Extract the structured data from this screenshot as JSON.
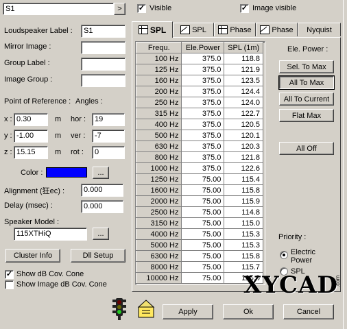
{
  "top": {
    "selector_value": "S1",
    "nav_arrow": ">",
    "visible_label": "Visible",
    "image_visible_label": "Image visible"
  },
  "left": {
    "loudspeaker_label": "Loudspeaker Label :",
    "loudspeaker_value": "S1",
    "mirror_image": "Mirror Image :",
    "group_label": "Group Label :",
    "image_group": "Image Group :",
    "point_of_reference": "Point of Reference :",
    "angles": "Angles :",
    "x_label": "x :",
    "x_value": "0.30",
    "x_unit": "m",
    "y_label": "y :",
    "y_value": "-1.00",
    "y_unit": "m",
    "z_label": "z :",
    "z_value": "15.15",
    "z_unit": "m",
    "hor_label": "hor :",
    "hor_value": "19",
    "ver_label": "ver :",
    "ver_value": "-7",
    "rot_label": "rot :",
    "rot_value": "0",
    "color_label": "Color :",
    "color_value": "#0000ff",
    "ellipsis": "...",
    "alignment_label": "Alignment (狂ec) :",
    "alignment_value": "0.000",
    "delay_label": "Delay (msec) :",
    "delay_value": "0.000",
    "speaker_model_label": "Speaker Model :",
    "speaker_model_value": "115XTHiQ",
    "cluster_info": "Cluster Info",
    "dll_setup": "Dll Setup",
    "show_db_cov": "Show dB Cov. Cone",
    "show_image_db_cov": "Show Image dB Cov. Cone"
  },
  "tabs": [
    {
      "label": "SPL",
      "icon": "grid-icon"
    },
    {
      "label": "SPL",
      "icon": "graph-icon"
    },
    {
      "label": "Phase",
      "icon": "grid-icon"
    },
    {
      "label": "Phase",
      "icon": "graph-icon"
    },
    {
      "label": "Nyquist",
      "icon": ""
    }
  ],
  "table": {
    "headers": [
      "Frequ.",
      "Ele.Power",
      "SPL (1m)"
    ],
    "rows": [
      [
        "100 Hz",
        "375.0",
        "118.8"
      ],
      [
        "125 Hz",
        "375.0",
        "121.9"
      ],
      [
        "160 Hz",
        "375.0",
        "123.5"
      ],
      [
        "200 Hz",
        "375.0",
        "124.4"
      ],
      [
        "250 Hz",
        "375.0",
        "124.0"
      ],
      [
        "315 Hz",
        "375.0",
        "122.7"
      ],
      [
        "400 Hz",
        "375.0",
        "120.5"
      ],
      [
        "500 Hz",
        "375.0",
        "120.1"
      ],
      [
        "630 Hz",
        "375.0",
        "120.3"
      ],
      [
        "800 Hz",
        "375.0",
        "121.8"
      ],
      [
        "1000 Hz",
        "375.0",
        "122.6"
      ],
      [
        "1250 Hz",
        "75.00",
        "115.4"
      ],
      [
        "1600 Hz",
        "75.00",
        "115.8"
      ],
      [
        "2000 Hz",
        "75.00",
        "115.9"
      ],
      [
        "2500 Hz",
        "75.00",
        "114.8"
      ],
      [
        "3150 Hz",
        "75.00",
        "115.0"
      ],
      [
        "4000 Hz",
        "75.00",
        "115.3"
      ],
      [
        "5000 Hz",
        "75.00",
        "115.3"
      ],
      [
        "6300 Hz",
        "75.00",
        "115.8"
      ],
      [
        "8000 Hz",
        "75.00",
        "115.7"
      ],
      [
        "10000 Hz",
        "75.00",
        "115.0"
      ]
    ]
  },
  "right": {
    "ele_power": "Ele. Power :",
    "sel_to_max": "Sel. To Max",
    "all_to_max": "All To Max",
    "all_to_current": "All To Current",
    "flat_max": "Flat Max",
    "all_off": "All Off",
    "priority": "Priority :",
    "electric_power": "Electric Power",
    "spl": "SPL"
  },
  "bottom": {
    "apply": "Apply",
    "ok": "Ok",
    "cancel": "Cancel"
  },
  "watermark": "XYCAD",
  "watermark_suffix": ".com"
}
